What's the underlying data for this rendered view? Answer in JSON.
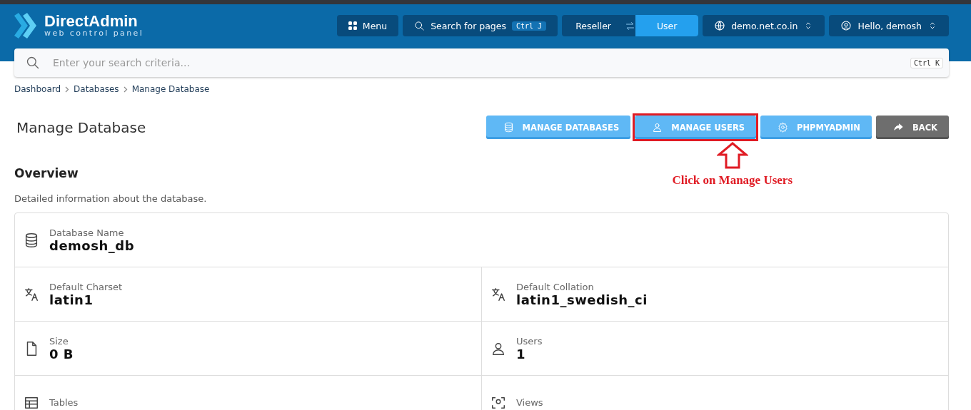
{
  "header": {
    "logo": {
      "title": "DirectAdmin",
      "subtitle": "web control panel"
    },
    "menu_button": "Menu",
    "page_search": {
      "label": "Search for pages",
      "shortcut": "Ctrl J"
    },
    "roles": [
      {
        "label": "Reseller",
        "selected": false
      },
      {
        "label": "User",
        "selected": true
      }
    ],
    "domain": "demo.net.co.in",
    "user_menu": "Hello, demosh"
  },
  "search": {
    "placeholder": "Enter your search criteria...",
    "shortcut": "Ctrl K"
  },
  "breadcrumb": [
    "Dashboard",
    "Databases",
    "Manage Database"
  ],
  "page_title": "Manage Database",
  "actions": [
    {
      "label": "MANAGE DATABASES",
      "kind": "primary",
      "highlighted": false
    },
    {
      "label": "MANAGE USERS",
      "kind": "primary",
      "highlighted": true
    },
    {
      "label": "PHPMYADMIN",
      "kind": "primary",
      "highlighted": false
    },
    {
      "label": "BACK",
      "kind": "secondary",
      "highlighted": false
    }
  ],
  "annotation": {
    "text": "Click on Manage Users"
  },
  "overview": {
    "title": "Overview",
    "description": "Detailed information about the database.",
    "rows": [
      [
        {
          "label": "Database Name",
          "value": "demosh_db"
        }
      ],
      [
        {
          "label": "Default Charset",
          "value": "latin1"
        },
        {
          "label": "Default Collation",
          "value": "latin1_swedish_ci"
        }
      ],
      [
        {
          "label": "Size",
          "value": "0 B"
        },
        {
          "label": "Users",
          "value": "1"
        }
      ],
      [
        {
          "label": "Tables"
        },
        {
          "label": "Views"
        }
      ]
    ]
  }
}
